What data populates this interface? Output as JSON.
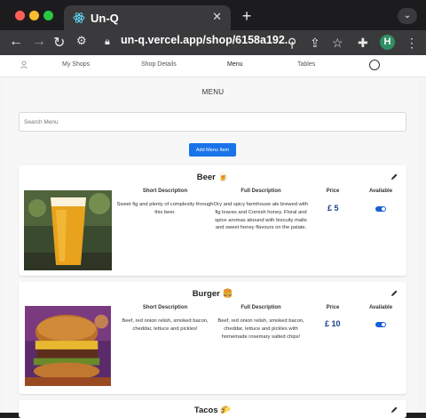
{
  "browser": {
    "tab_title": "Un-Q",
    "tab_close": "✕",
    "new_tab": "+",
    "url": "un-q.vercel.app/shop/6158a192...",
    "profile_initial": "H"
  },
  "nav": {
    "items": [
      "My Shops",
      "Shop Details",
      "Menu",
      "Tables"
    ]
  },
  "page": {
    "title": "MENU",
    "search_placeholder": "Search Menu",
    "add_button": "Add Menu Item"
  },
  "columns": {
    "short": "Short Description",
    "full": "Full Description",
    "price": "Price",
    "available": "Available"
  },
  "items": [
    {
      "name": "Beer 🍺",
      "short_description": "Sweet fig and plenty of complexity through this beer.",
      "full_description": "Dry and spicy farmhouse ale brewed with fig leaves and Cornish honey. Floral and spice aromas abound with biscuity malts and sweet honey flavours on the palate.",
      "price": "£ 5",
      "available": true
    },
    {
      "name": "Burger 🍔",
      "short_description": "Beef, red onion relish, smoked bacon, cheddar, lettuce and pickles!",
      "full_description": "Beef, red onion relish, smoked bacon, cheddar, lettuce and pickles with homemade rosemary salted chips!",
      "price": "£ 10",
      "available": true
    },
    {
      "name": "Tacos 🌮"
    }
  ],
  "colors": {
    "accent": "#1a73e8",
    "price": "#1a3e8e"
  }
}
